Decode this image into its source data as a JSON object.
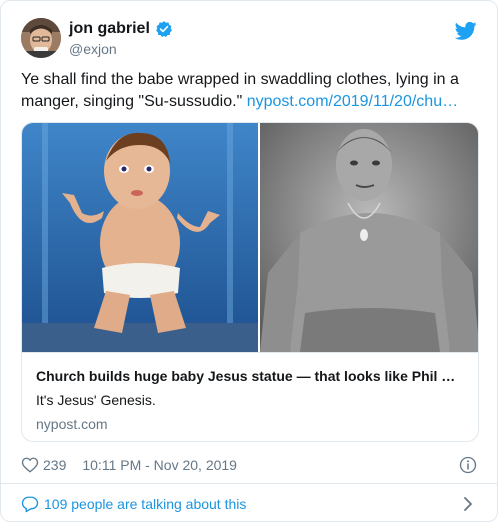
{
  "colors": {
    "link": "#1b95e0",
    "secondary_text": "#657786",
    "border": "#e1e8ed",
    "verified": "#1da1f2"
  },
  "author": {
    "display_name": "jon gabriel",
    "handle": "@exjon",
    "verified_icon": "verified-badge-icon",
    "avatar_icon": "avatar"
  },
  "brand_icon": "twitter-bird-icon",
  "tweet": {
    "text": "Ye shall find the babe wrapped in swaddling clothes, lying in a manger, singing \"Su-sussudio.\" ",
    "link": "nypost.com/2019/11/20/chu…"
  },
  "link_card": {
    "title": "Church builds huge baby Jesus statue — that looks like Phil …",
    "description": "It's Jesus' Genesis.",
    "domain": "nypost.com"
  },
  "meta": {
    "like_count": "239",
    "timestamp": "10:11 PM - Nov 20, 2019"
  },
  "footer": {
    "conversation_text": "109 people are talking about this"
  }
}
